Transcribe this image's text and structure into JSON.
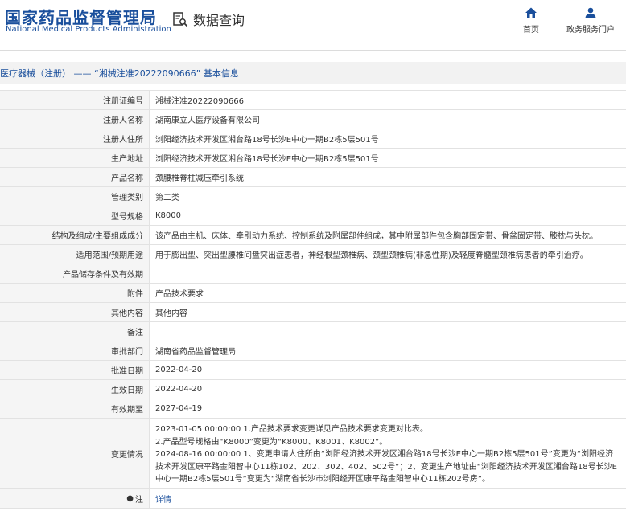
{
  "header": {
    "logo_cn": "国家药品监督管理局",
    "logo_en": "National Medical Products Administration",
    "query_label": "数据查询",
    "nav": {
      "home": "首页",
      "portal": "政务服务门户"
    }
  },
  "breadcrumb": "医疗器械（注册） —— “湘械注准20222090666” 基本信息",
  "rows": [
    {
      "label": "注册证编号",
      "value": "湘械注准20222090666"
    },
    {
      "label": "注册人名称",
      "value": "湖南康立人医疗设备有限公司"
    },
    {
      "label": "注册人住所",
      "value": "浏阳经济技术开发区湘台路18号长沙E中心一期B2栋5层501号"
    },
    {
      "label": "生产地址",
      "value": "浏阳经济技术开发区湘台路18号长沙E中心一期B2栋5层501号"
    },
    {
      "label": "产品名称",
      "value": "颈腰椎脊柱减压牵引系统"
    },
    {
      "label": "管理类别",
      "value": "第二类"
    },
    {
      "label": "型号规格",
      "value": "K8000"
    },
    {
      "label": "结构及组成/主要组成成分",
      "value": "该产品由主机、床体、牵引动力系统、控制系统及附属部件组成，其中附属部件包含胸部固定带、骨盆固定带、膝枕与头枕。"
    },
    {
      "label": "适用范围/预期用途",
      "value": "用于膨出型、突出型腰椎间盘突出症患者，神经根型颈椎病、颈型颈椎病(非急性期)及轻度脊髓型颈椎病患者的牵引治疗。"
    },
    {
      "label": "产品储存条件及有效期",
      "value": ""
    },
    {
      "label": "附件",
      "value": "产品技术要求"
    },
    {
      "label": "其他内容",
      "value": "其他内容"
    },
    {
      "label": "备注",
      "value": ""
    },
    {
      "label": "审批部门",
      "value": "湖南省药品监督管理局"
    },
    {
      "label": "批准日期",
      "value": "2022-04-20"
    },
    {
      "label": "生效日期",
      "value": "2022-04-20"
    },
    {
      "label": "有效期至",
      "value": "2027-04-19"
    }
  ],
  "changes": {
    "label": "变更情况",
    "lines": [
      "2023-01-05 00:00:00 1.产品技术要求变更详见产品技术要求变更对比表。",
      "2.产品型号规格由“K8000”变更为“K8000、K8001、K8002”。",
      "2024-08-16 00:00:00 1、变更申请人住所由“浏阳经济技术开发区湘台路18号长沙E中心一期B2栋5层501号”变更为“浏阳经济技术开发区康平路金阳智中心11栋102、202、302、402、502号”；2、变更生产地址由“浏阳经济技术开发区湘台路18号长沙E中心一期B2栋5层501号”变更为“湖南省长沙市浏阳经开区康平路金阳智中心11栋202号房”。"
    ]
  },
  "note": {
    "label": "注",
    "link": "详情"
  },
  "colors": {
    "brand": "#1a4f9c",
    "label_bg": "#f5f5f5",
    "crumb_bg": "#f2f2f2",
    "border": "#e2e2e2"
  }
}
